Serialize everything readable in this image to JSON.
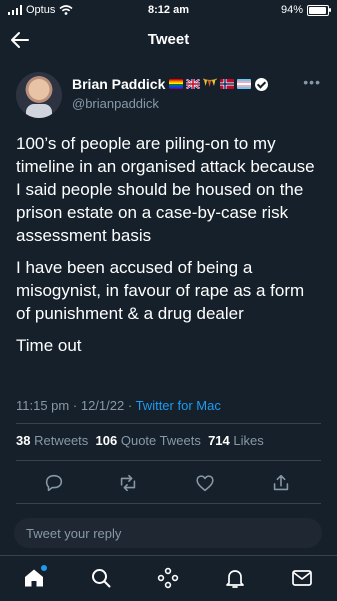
{
  "status_bar": {
    "carrier": "Optus",
    "time": "8:12 am",
    "battery": "94%",
    "battery_fraction": 0.94
  },
  "nav": {
    "title": "Tweet"
  },
  "author": {
    "display_name": "Brian Paddick",
    "handle": "@brianpaddick",
    "flags": [
      "rainbow-flag",
      "union-jack-flag",
      "bunting-emoji",
      "norway-flag",
      "transgender-flag"
    ]
  },
  "tweet": {
    "paragraphs": [
      "100’s of people are piling-on to my timeline in an organised attack because I said people should be housed on the prison estate on a case-by-case risk assessment basis",
      "I have been accused of being a misogynist, in favour of rape as a form of punishment & a drug dealer",
      "Time out"
    ],
    "time": "11:15 pm",
    "date": "12/1/22",
    "separator": "·",
    "source": "Twitter for Mac"
  },
  "stats": {
    "retweets_count": "38",
    "retweets_label": "Retweets",
    "quotes_count": "106",
    "quotes_label": "Quote Tweets",
    "likes_count": "714",
    "likes_label": "Likes"
  },
  "reply": {
    "placeholder": "Tweet your reply"
  },
  "colors": {
    "background": "#15202b",
    "accent": "#1d9bf0",
    "secondary_text": "#8899a6",
    "divider": "#38444d"
  }
}
